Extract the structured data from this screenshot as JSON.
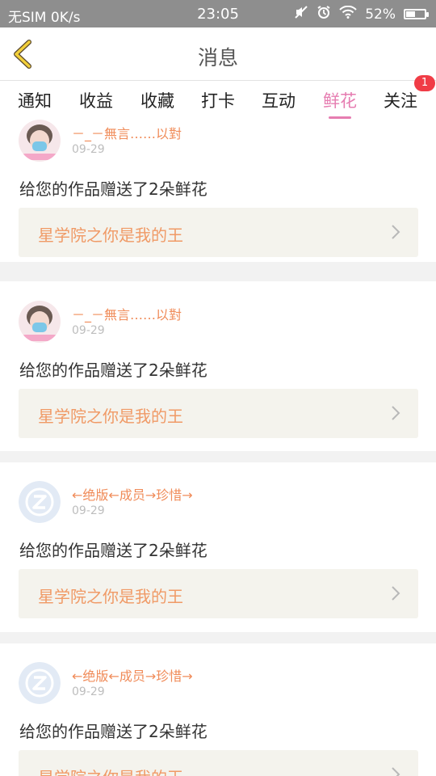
{
  "status_bar": {
    "carrier": "无SIM 0K/s",
    "time": "23:05",
    "battery": "52%",
    "battery_level": 0.52,
    "icons": [
      "mute-icon",
      "alarm-icon",
      "wifi-icon",
      "battery-icon"
    ]
  },
  "header": {
    "title": "消息",
    "back_icon": "chevron-left-icon"
  },
  "tabs": [
    {
      "label": "通知",
      "active": false
    },
    {
      "label": "收益",
      "active": false
    },
    {
      "label": "收藏",
      "active": false
    },
    {
      "label": "打卡",
      "active": false
    },
    {
      "label": "互动",
      "active": false
    },
    {
      "label": "鲜花",
      "active": true
    },
    {
      "label": "关注",
      "active": false,
      "badge": "1"
    }
  ],
  "colors": {
    "accent_pink": "#e67db1",
    "username_orange": "#f08c5a",
    "link_orange": "#f09a66",
    "badge_red": "#f03c46"
  },
  "messages": [
    {
      "user": "－_－無言……以對",
      "date": "09-29",
      "text": "给您的作品赠送了2朵鲜花",
      "work": "星学院之你是我的王",
      "avatar": "photo-avatar"
    },
    {
      "user": "－_－無言……以對",
      "date": "09-29",
      "text": "给您的作品赠送了2朵鲜花",
      "work": "星学院之你是我的王",
      "avatar": "photo-avatar"
    },
    {
      "user": "←绝版←成员→珍惜→",
      "date": "09-29",
      "text": "给您的作品赠送了2朵鲜花",
      "work": "星学院之你是我的王",
      "avatar": "default-avatar"
    },
    {
      "user": "←绝版←成员→珍惜→",
      "date": "09-29",
      "text": "给您的作品赠送了2朵鲜花",
      "work": "星学院之你是我的王",
      "avatar": "default-avatar"
    }
  ]
}
